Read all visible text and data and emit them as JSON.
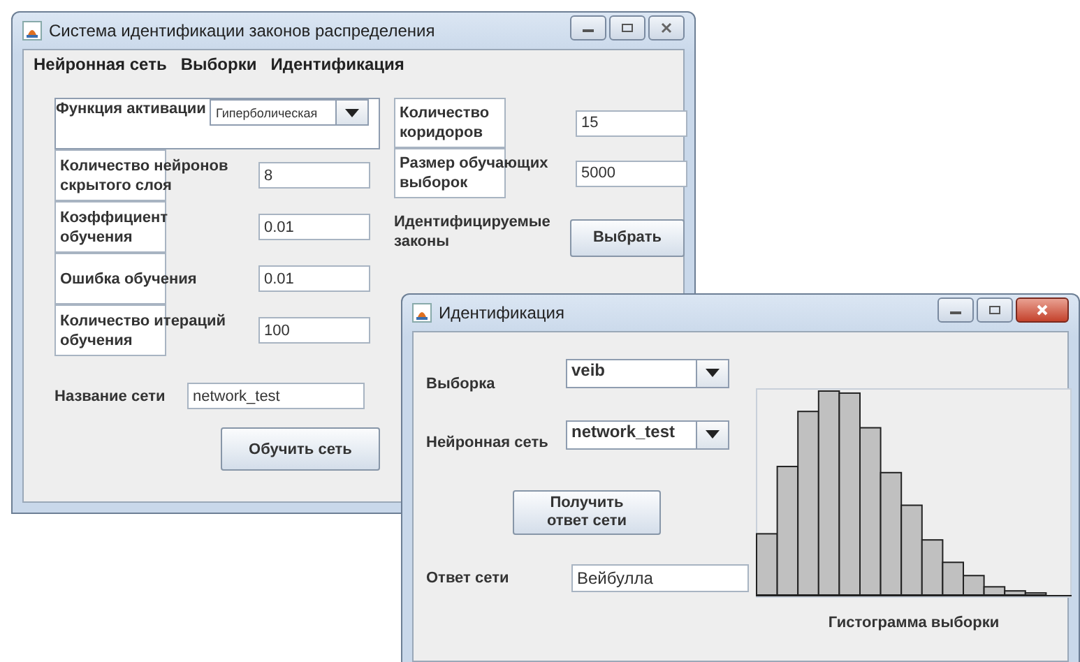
{
  "main_window": {
    "title": "Система идентификации законов распределения",
    "menu": [
      "Нейронная сеть",
      "Выборки",
      "Идентификация"
    ],
    "left_rows": [
      {
        "kind": "combo",
        "label": "Функция активации",
        "value": "Гиперболическая"
      },
      {
        "kind": "field",
        "label": "Количество нейронов\nскрытого слоя",
        "value": "8"
      },
      {
        "kind": "field",
        "label": "Коэффициент\nобучения",
        "value": "0.01"
      },
      {
        "kind": "field",
        "label": "Ошибка обучения",
        "value": "0.01"
      },
      {
        "kind": "field",
        "label": "Количество итераций\nобучения",
        "value": "100"
      }
    ],
    "network_name": {
      "label": "Название сети",
      "value": "network_test"
    },
    "train_button": "Обучить сеть",
    "right_rows": [
      {
        "kind": "field",
        "label": "Количество\nкоридоров",
        "value": "15"
      },
      {
        "kind": "field",
        "label": "Размер обучающих\nвыборок",
        "value": "5000"
      },
      {
        "kind": "button",
        "label": "Идентифицируемые\nзаконы",
        "value": "Выбрать"
      }
    ]
  },
  "identification_window": {
    "title": "Идентификация",
    "sample": {
      "label": "Выборка",
      "value": "veib"
    },
    "network": {
      "label": "Нейронная сеть",
      "value": "network_test"
    },
    "answer_button": "Получить\nответ сети",
    "answer": {
      "label": "Ответ сети",
      "value": "Вейбулла"
    },
    "histogram_caption": "Гистограмма выборки"
  }
}
